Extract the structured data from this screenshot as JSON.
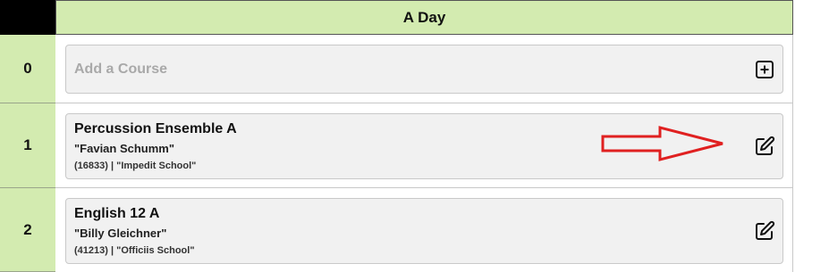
{
  "header": {
    "day_title": "A Day"
  },
  "rows": [
    {
      "period": "0",
      "placeholder": "Add a Course",
      "action_icon": "plus-square-icon"
    },
    {
      "period": "1",
      "course": "Percussion Ensemble A",
      "teacher": "\"Favian Schumm\"",
      "meta": "(16833) | \"Impedit School\"",
      "action_icon": "edit-icon"
    },
    {
      "period": "2",
      "course": "English 12 A",
      "teacher": "\"Billy Gleichner\"",
      "meta": "(41213) | \"Officiis School\"",
      "action_icon": "edit-icon"
    }
  ],
  "annotation": {
    "arrow_color": "#e02020",
    "arrow_icon": "red-arrow-right"
  },
  "colors": {
    "label_bg": "#d3ebb0",
    "card_bg": "#f1f1f1"
  }
}
